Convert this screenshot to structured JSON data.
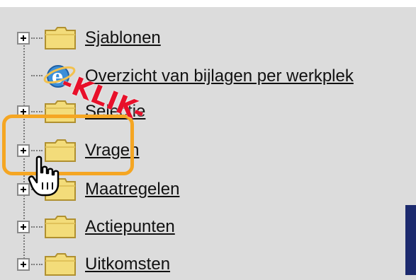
{
  "tree": {
    "items": [
      {
        "label": "Sjablonen",
        "icon": "folder-icon"
      },
      {
        "label": "Overzicht van bijlagen per werkplek",
        "icon": "ie-globe-icon"
      },
      {
        "label": "Selectie",
        "icon": "folder-icon"
      },
      {
        "label": "Vragen",
        "icon": "folder-icon"
      },
      {
        "label": "Maatregelen",
        "icon": "folder-icon"
      },
      {
        "label": "Actiepunten",
        "icon": "folder-icon"
      },
      {
        "label": "Uitkomsten",
        "icon": "folder-icon"
      }
    ]
  },
  "annotation": {
    "text": "-KLIK-",
    "color": "#e8102a",
    "highlight_color": "#f5a623"
  },
  "colors": {
    "background": "#dcdcdc",
    "folder_fill": "#f3dc7a",
    "folder_stroke": "#b09030",
    "corner_panel": "#1c2a6e"
  }
}
